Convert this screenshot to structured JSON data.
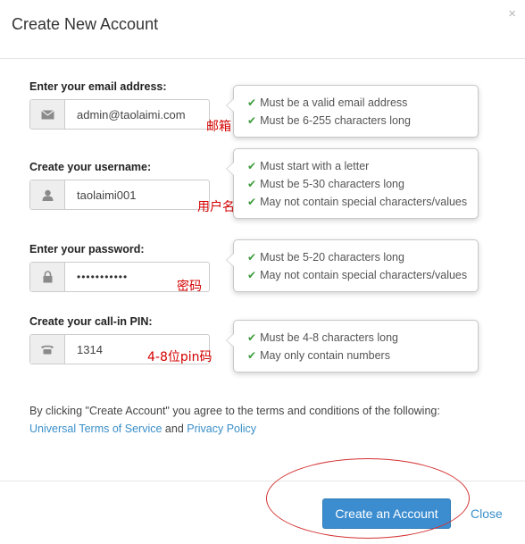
{
  "header": {
    "title": "Create New Account",
    "close_glyph": "×"
  },
  "fields": [
    {
      "label": "Enter your email address:",
      "value": "admin@taolaimi.com",
      "icon": "envelope-icon",
      "annotation": "邮箱"
    },
    {
      "label": "Create your username:",
      "value": "taolaimi001",
      "icon": "user-icon",
      "annotation": "用户名"
    },
    {
      "label": "Enter your password:",
      "value": "•••••••••••",
      "icon": "lock-icon",
      "annotation": "密码"
    },
    {
      "label": "Create your call-in PIN:",
      "value": "1314",
      "icon": "phone-icon",
      "annotation": "4-8位pin码"
    }
  ],
  "popovers": [
    [
      "Must be a valid email address",
      "Must be 6-255 characters long"
    ],
    [
      "Must start with a letter",
      "Must be 5-30 characters long",
      "May not contain special characters/values"
    ],
    [
      "Must be 5-20 characters long",
      "May not contain special characters/values"
    ],
    [
      "Must be 4-8 characters long",
      "May only contain numbers"
    ]
  ],
  "terms": {
    "text": "By clicking \"Create Account\" you agree to the terms and conditions of the following:",
    "link1": "Universal Terms of Service",
    "and": "and",
    "link2": "Privacy Policy"
  },
  "footer": {
    "create_label": "Create an Account",
    "close_label": "Close"
  },
  "colors": {
    "primary": "#3c8dd0",
    "link": "#3a8fc9",
    "check": "#3c9b3c",
    "annotation": "#d40000"
  }
}
